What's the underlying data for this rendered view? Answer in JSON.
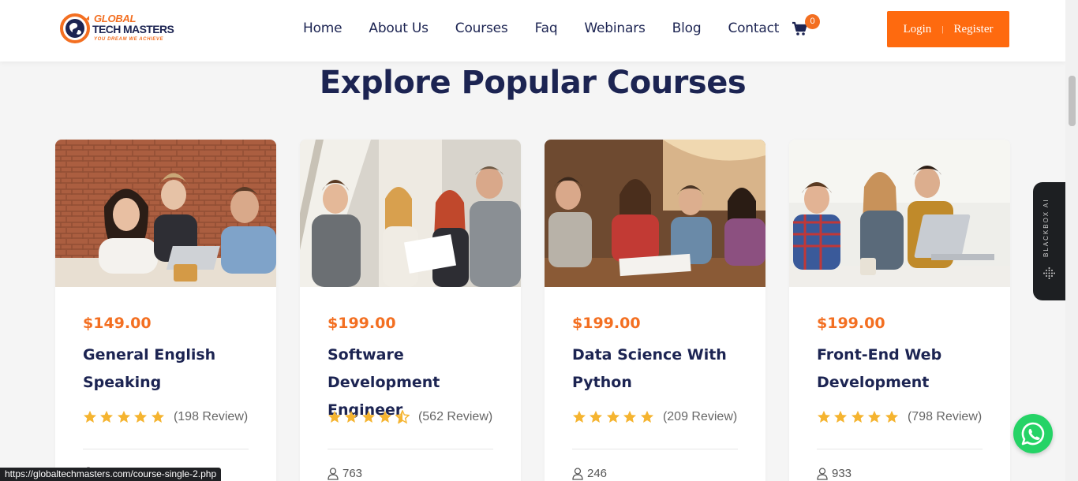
{
  "header": {
    "logo": {
      "line1": "GLOBAL",
      "line2": "TECH MASTERS",
      "tagline": "YOU DREAM WE ACHIEVE"
    },
    "nav": [
      "Home",
      "About Us",
      "Courses",
      "Faq",
      "Webinars",
      "Blog",
      "Contact"
    ],
    "cart_count": "0",
    "login_label": "Login",
    "separator": "|",
    "register_label": "Register"
  },
  "section_title": "Explore Popular Courses",
  "courses": [
    {
      "price": "$149.00",
      "title": "General English Speaking",
      "rating": 5,
      "reviews": "(198 Review)",
      "students": ""
    },
    {
      "price": "$199.00",
      "title": "Software Development Engineer",
      "rating": 4.5,
      "reviews": "(562 Review)",
      "students": "763"
    },
    {
      "price": "$199.00",
      "title": "Data Science With Python",
      "rating": 5,
      "reviews": "(209 Review)",
      "students": "246"
    },
    {
      "price": "$199.00",
      "title": "Front-End Web Development",
      "rating": 5,
      "reviews": "(798 Review)",
      "students": "933"
    }
  ],
  "side_tab": {
    "label": "BLACKBOX AI"
  },
  "status_url": "https://globaltechmasters.com/course-single-2.php",
  "colors": {
    "accent": "#f36f21",
    "navy": "#1c2452",
    "star": "#f5b430",
    "whatsapp": "#25d366"
  }
}
